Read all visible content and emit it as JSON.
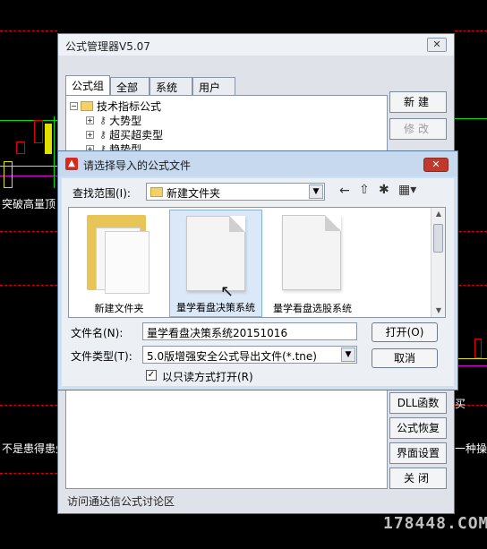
{
  "background": {
    "left_text": "突破高量顶",
    "bottom_left_text": "不是患得患失",
    "bottom_right_text": "一种操盘",
    "right_char": "买"
  },
  "manager": {
    "title": "公式管理器V5.07",
    "close_label": "✕",
    "tabs": [
      "公式组",
      "全部",
      "系统",
      "用户"
    ],
    "tree": {
      "root": "技术指标公式",
      "children": [
        "大势型",
        "超买超卖型",
        "趋势型"
      ]
    },
    "buttons": {
      "new": "新建",
      "modify": "修改",
      "dll": "DLL函数",
      "restore": "公式恢复",
      "ui_settings": "界面设置",
      "close": "关闭"
    },
    "footer_link": "访问通达信公式讨论区"
  },
  "dialog": {
    "title": "请选择导入的公式文件",
    "close_label": "✕",
    "look_in_label": "查找范围(I):",
    "look_in_value": "新建文件夹",
    "files": [
      {
        "name": "新建文件夹",
        "type": "folder"
      },
      {
        "name": "量学看盘决策系统",
        "type": "file",
        "selected": true
      },
      {
        "name": "量学看盘选股系统",
        "type": "file"
      }
    ],
    "filename_label": "文件名(N):",
    "filename_value": "量学看盘决策系统20151016",
    "filetype_label": "文件类型(T):",
    "filetype_value": "5.0版增强安全公式导出文件(*.tne)",
    "open_button": "打开(O)",
    "cancel_button": "取消",
    "readonly_label": "以只读方式打开(R)",
    "readonly_checked": true
  },
  "watermark": "178448.COM",
  "colors": {
    "chart_green": "#00e000",
    "chart_red": "#e00000",
    "chart_magenta": "#e000e0",
    "chart_yellow": "#e0e000",
    "dialog_close": "#c0392b"
  }
}
